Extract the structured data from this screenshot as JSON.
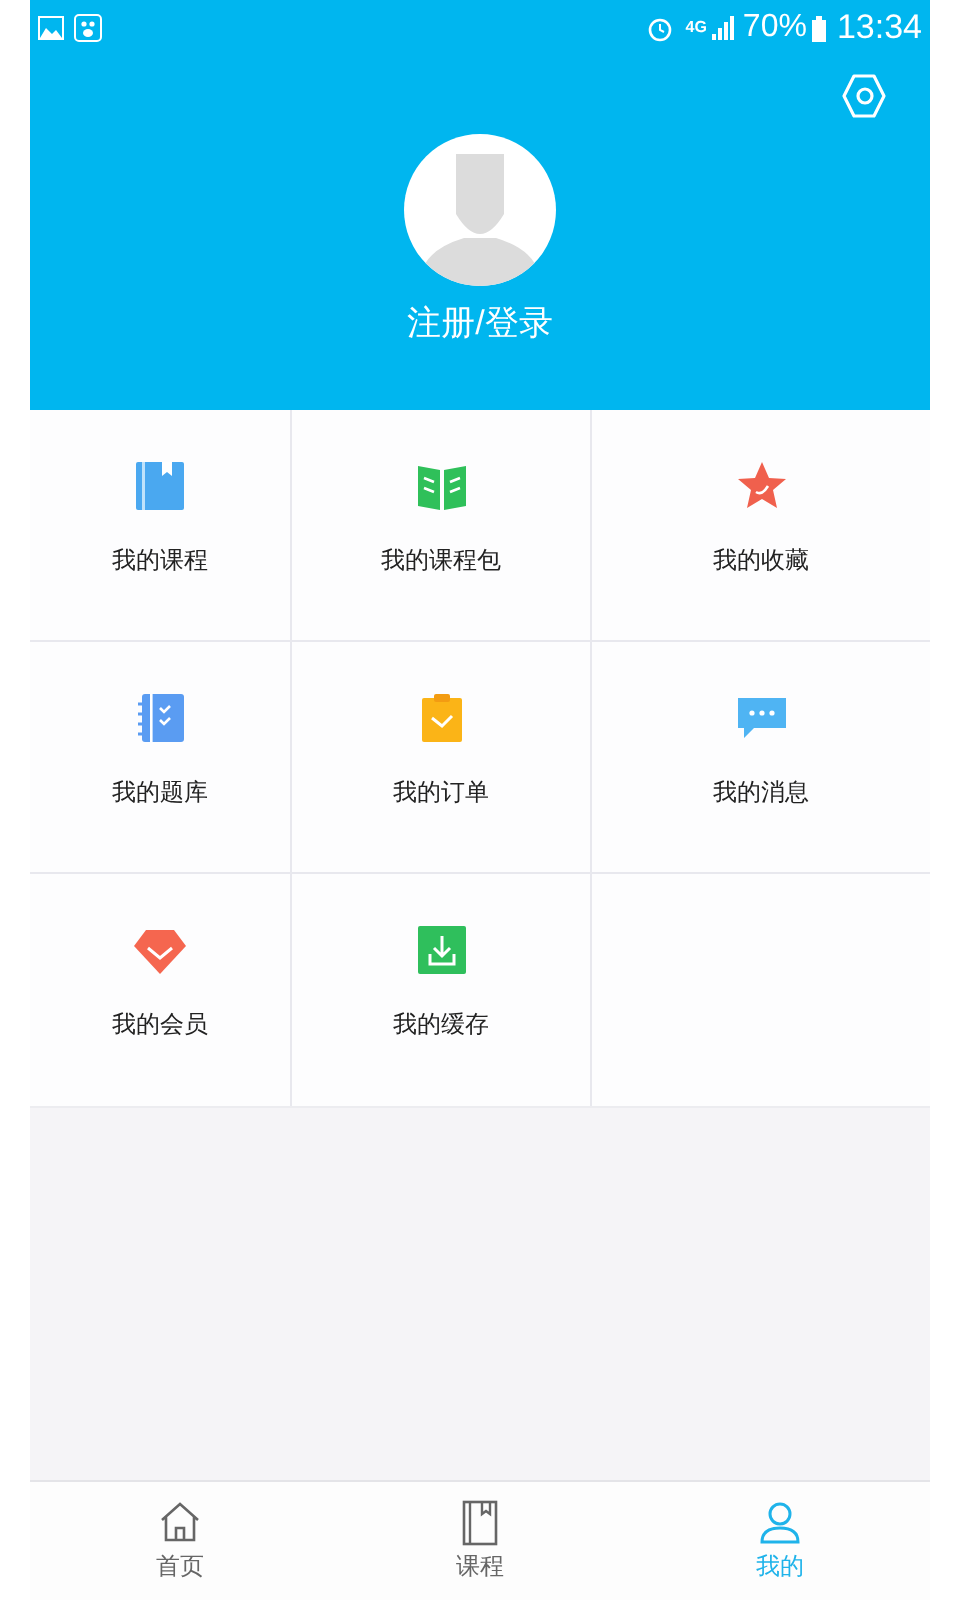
{
  "status_bar": {
    "network": "4G",
    "battery": "70%",
    "time": "13:34"
  },
  "profile": {
    "login_label": "注册/登录"
  },
  "menu": [
    {
      "label": "我的课程"
    },
    {
      "label": "我的课程包"
    },
    {
      "label": "我的收藏"
    },
    {
      "label": "我的题库"
    },
    {
      "label": "我的订单"
    },
    {
      "label": "我的消息"
    },
    {
      "label": "我的会员"
    },
    {
      "label": "我的缓存"
    }
  ],
  "tabs": [
    {
      "label": "首页",
      "selected": false
    },
    {
      "label": "课程",
      "selected": false
    },
    {
      "label": "我的",
      "selected": true
    }
  ]
}
